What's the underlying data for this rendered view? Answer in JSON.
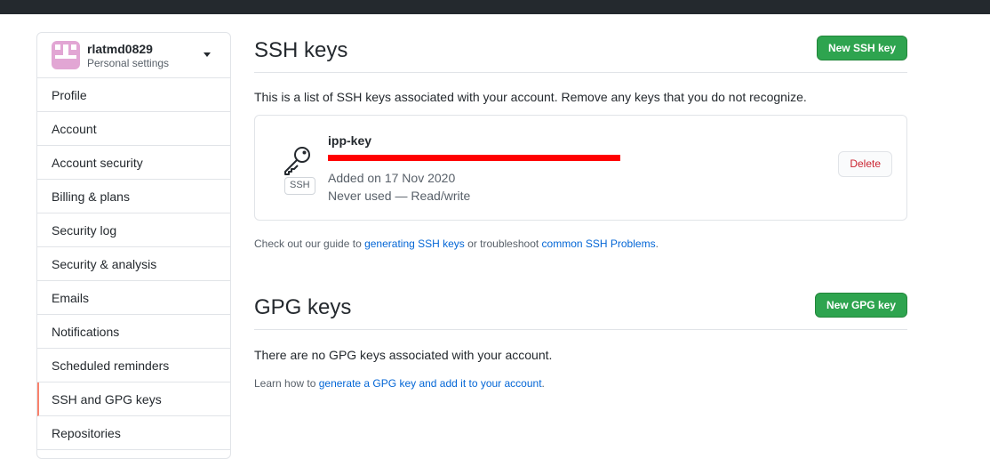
{
  "user": {
    "name": "rlatmd0829",
    "subtitle": "Personal settings"
  },
  "sidebar": {
    "items": [
      {
        "label": "Profile"
      },
      {
        "label": "Account"
      },
      {
        "label": "Account security"
      },
      {
        "label": "Billing & plans"
      },
      {
        "label": "Security log"
      },
      {
        "label": "Security & analysis"
      },
      {
        "label": "Emails"
      },
      {
        "label": "Notifications"
      },
      {
        "label": "Scheduled reminders"
      },
      {
        "label": "SSH and GPG keys",
        "selected": true
      },
      {
        "label": "Repositories"
      }
    ]
  },
  "ssh": {
    "title": "SSH keys",
    "new_button": "New SSH key",
    "description": "This is a list of SSH keys associated with your account. Remove any keys that you do not recognize.",
    "key": {
      "name": "ipp-key",
      "badge": "SSH",
      "added": "Added on 17 Nov 2020",
      "usage": "Never used — Read/write",
      "delete_label": "Delete"
    },
    "help": {
      "prefix": "Check out our guide to ",
      "link1": "generating SSH keys",
      "middle": " or troubleshoot ",
      "link2": "common SSH Problems",
      "suffix": "."
    }
  },
  "gpg": {
    "title": "GPG keys",
    "new_button": "New GPG key",
    "empty": "There are no GPG keys associated with your account.",
    "help": {
      "prefix": "Learn how to ",
      "link": "generate a GPG key and add it to your account",
      "suffix": "."
    }
  },
  "colors": {
    "header": "#24292e",
    "primary_button": "#2ea44f",
    "danger": "#cb2431",
    "link": "#0366d6",
    "selected_marker": "#f9826c",
    "redaction": "#ff0000"
  }
}
